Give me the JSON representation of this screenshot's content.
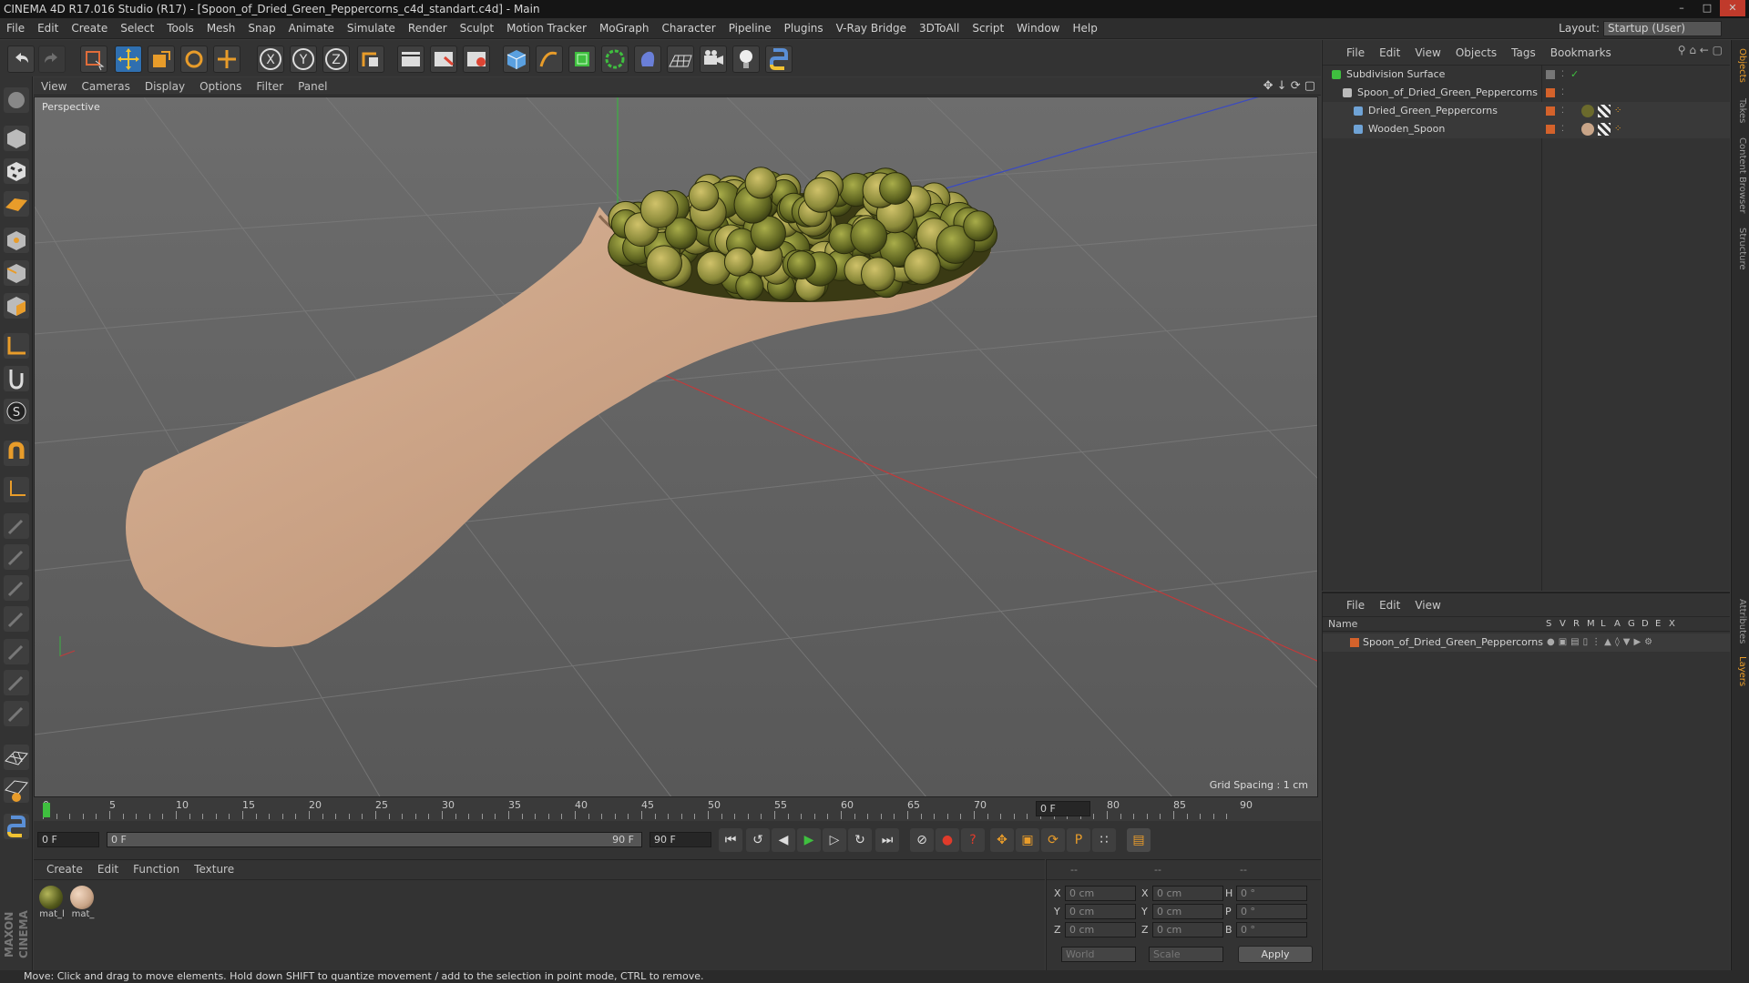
{
  "window": {
    "title": "CINEMA 4D R17.016 Studio (R17) - [Spoon_of_Dried_Green_Peppercorns_c4d_standart.c4d] - Main"
  },
  "menu": [
    "File",
    "Edit",
    "Create",
    "Select",
    "Tools",
    "Mesh",
    "Snap",
    "Animate",
    "Simulate",
    "Render",
    "Sculpt",
    "Motion Tracker",
    "MoGraph",
    "Character",
    "Pipeline",
    "Plugins",
    "V-Ray Bridge",
    "3DToAll",
    "Script",
    "Window",
    "Help"
  ],
  "layout": {
    "label": "Layout:",
    "value": "Startup (User)"
  },
  "viewport": {
    "menu": [
      "View",
      "Cameras",
      "Display",
      "Options",
      "Filter",
      "Panel"
    ],
    "label": "Perspective",
    "grid_spacing": "Grid Spacing : 1 cm"
  },
  "timeline": {
    "ticks": [
      "0",
      "5",
      "10",
      "15",
      "20",
      "25",
      "30",
      "35",
      "40",
      "45",
      "50",
      "55",
      "60",
      "65",
      "70",
      "75",
      "80",
      "85",
      "90"
    ],
    "current": "0 F"
  },
  "timebar": {
    "start": "0 F",
    "range_start": "0 F",
    "range_end": "90 F",
    "end": "90 F"
  },
  "materials": {
    "menu": [
      "Create",
      "Edit",
      "Function",
      "Texture"
    ],
    "items": [
      {
        "label": "mat_l",
        "color": "#6b6a2c"
      },
      {
        "label": "mat_",
        "color": "#c9a588"
      }
    ]
  },
  "coords": {
    "headers": [
      "--",
      "--",
      "--"
    ],
    "rows": [
      {
        "a": "X",
        "av": "0 cm",
        "b": "X",
        "bv": "0 cm",
        "c": "H",
        "cv": "0 °"
      },
      {
        "a": "Y",
        "av": "0 cm",
        "b": "Y",
        "bv": "0 cm",
        "c": "P",
        "cv": "0 °"
      },
      {
        "a": "Z",
        "av": "0 cm",
        "b": "Z",
        "bv": "0 cm",
        "c": "B",
        "cv": "0 °"
      }
    ],
    "mode": "World",
    "scale": "Scale",
    "apply": "Apply"
  },
  "objects": {
    "menu": [
      "File",
      "Edit",
      "View",
      "Objects",
      "Tags",
      "Bookmarks"
    ],
    "rows": [
      {
        "name": "Subdivision Surface",
        "indent": 0,
        "icon_color": "#3fbf3f"
      },
      {
        "name": "Spoon_of_Dried_Green_Peppercorns",
        "indent": 1,
        "icon_color": "#bbbbbb"
      },
      {
        "name": "Dried_Green_Peppercorns",
        "indent": 2,
        "icon_color": "#6fa3d6"
      },
      {
        "name": "Wooden_Spoon",
        "indent": 2,
        "icon_color": "#6fa3d6"
      }
    ]
  },
  "layers": {
    "menu": [
      "File",
      "Edit",
      "View"
    ],
    "name_header": "Name",
    "cols": [
      "S",
      "V",
      "R",
      "M",
      "L",
      "A",
      "G",
      "D",
      "E",
      "X"
    ],
    "rows": [
      {
        "name": "Spoon_of_Dried_Green_Peppercorns",
        "color": "#d4622b"
      }
    ]
  },
  "side_tabs": [
    "Objects",
    "Takes",
    "Content Browser",
    "Structure",
    "Attributes",
    "Layers"
  ],
  "status": "Move: Click and drag to move elements. Hold down SHIFT to quantize movement / add to the selection in point mode, CTRL to remove.",
  "brand": "MAXON CINEMA 4D",
  "colors": {
    "accent": "#d4622b",
    "viewport_bg": "#5a5a5a",
    "active_tool": "#2f6fb0"
  }
}
